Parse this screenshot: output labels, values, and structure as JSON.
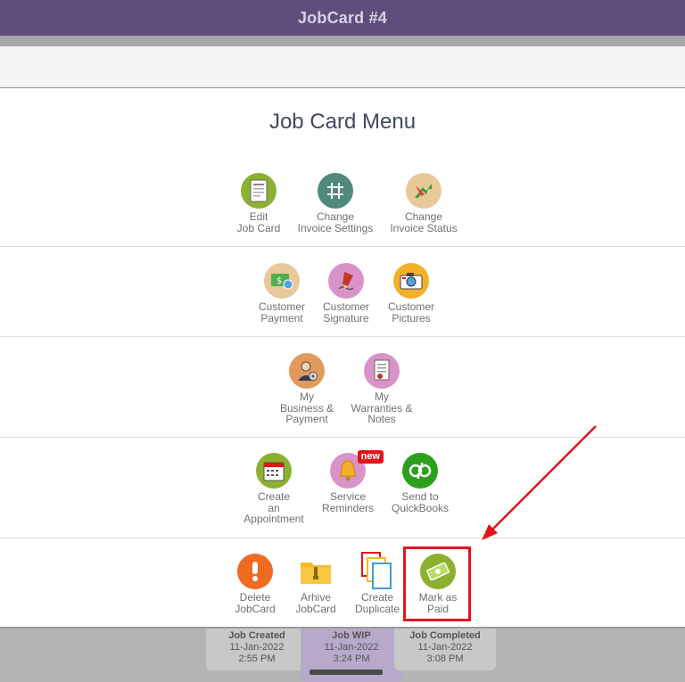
{
  "header": {
    "title": "JobCard #4"
  },
  "menu": {
    "title": "Job Card Menu",
    "items": [
      {
        "label": "Edit\nJob Card",
        "icon": "edit-jobcard-icon",
        "color": "#8cb131"
      },
      {
        "label": "Change\nInvoice Settings",
        "icon": "invoice-settings-icon",
        "color": "#4f8a7c"
      },
      {
        "label": "Change\nInvoice Status",
        "icon": "invoice-status-icon",
        "color": "#e9c89a"
      },
      {
        "label": "Customer\nPayment",
        "icon": "customer-payment-icon",
        "color": "#e9c89a"
      },
      {
        "label": "Customer\nSignature",
        "icon": "customer-signature-icon",
        "color": "#d993c9"
      },
      {
        "label": "Customer\nPictures",
        "icon": "customer-pictures-icon",
        "color": "#f3b02b"
      },
      {
        "label": "My\nBusiness &\nPayment",
        "icon": "business-payment-icon",
        "color": "#e29a5c"
      },
      {
        "label": "My\nWarranties &\nNotes",
        "icon": "warranties-notes-icon",
        "color": "#d993c9"
      },
      {
        "label": "Create\nan\nAppointment",
        "icon": "calendar-icon",
        "color": "#8cb131"
      },
      {
        "label": "Service\nReminders",
        "icon": "bell-icon",
        "color": "#d993c9",
        "badge": "new"
      },
      {
        "label": "Send to\nQuickBooks",
        "icon": "quickbooks-icon",
        "color": "#2ca01c"
      },
      {
        "label": "Delete\nJobCard",
        "icon": "exclamation-icon",
        "color": "#ef6a22"
      },
      {
        "label": "Arhive\nJobCard",
        "icon": "folder-zip-icon",
        "color": "#f4b92b"
      },
      {
        "label": "Create\nDuplicate",
        "icon": "duplicate-icon",
        "color": "#e2141b"
      },
      {
        "label": "Mark as\nPaid",
        "icon": "money-icon",
        "color": "#8cb131"
      }
    ]
  },
  "status": [
    {
      "title": "Job Created",
      "date": "11-Jan-2022",
      "time": "2:55 PM"
    },
    {
      "title": "Job WIP",
      "date": "11-Jan-2022",
      "time": "3:24 PM"
    },
    {
      "title": "Job Completed",
      "date": "11-Jan-2022",
      "time": "3:08 PM"
    }
  ],
  "annotation": {
    "color": "#e2141b"
  }
}
